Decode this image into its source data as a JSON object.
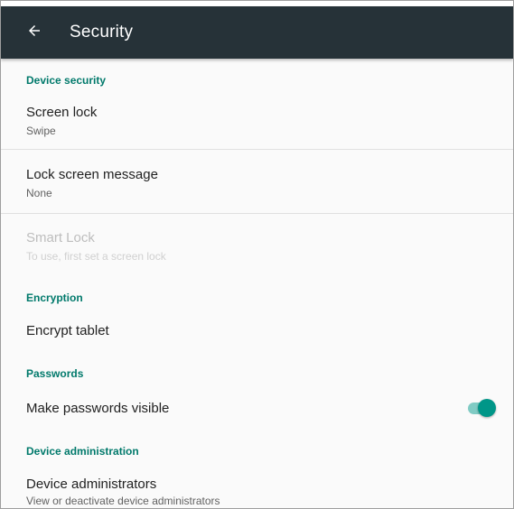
{
  "toolbar": {
    "back_icon": "arrow-back-icon",
    "title": "Security",
    "background_color": "#263238"
  },
  "accent_color": "#00796b",
  "sections": {
    "device_security": {
      "header": "Device security",
      "screen_lock": {
        "title": "Screen lock",
        "summary": "Swipe"
      },
      "lock_screen_message": {
        "title": "Lock screen message",
        "summary": "None"
      },
      "smart_lock": {
        "title": "Smart Lock",
        "summary": "To use, first set a screen lock",
        "enabled": false
      }
    },
    "encryption": {
      "header": "Encryption",
      "encrypt_tablet": {
        "title": "Encrypt tablet"
      }
    },
    "passwords": {
      "header": "Passwords",
      "make_passwords_visible": {
        "title": "Make passwords visible",
        "toggle_on": true
      }
    },
    "device_administration": {
      "header": "Device administration",
      "device_administrators": {
        "title": "Device administrators",
        "summary": "View or deactivate device administrators"
      }
    }
  }
}
